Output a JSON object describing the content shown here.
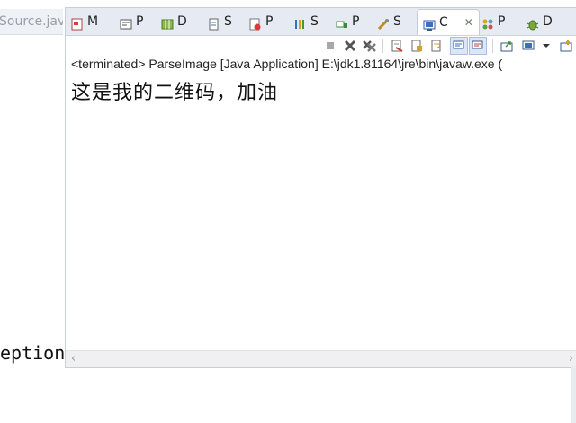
{
  "editor": {
    "tab_label": "Source.jav",
    "code_fragment": "eption",
    "code_rest": ";"
  },
  "tabs": [
    {
      "label": "M",
      "icon": "markers-icon"
    },
    {
      "label": "P",
      "icon": "properties-icon"
    },
    {
      "label": "D",
      "icon": "data-source-icon"
    },
    {
      "label": "S",
      "icon": "snippets-icon"
    },
    {
      "label": "P",
      "icon": "problems-icon"
    },
    {
      "label": "S",
      "icon": "search-icon"
    },
    {
      "label": "P",
      "icon": "progress-icon"
    },
    {
      "label": "S",
      "icon": "servers-icon"
    },
    {
      "label": "C",
      "icon": "console-icon",
      "active": true,
      "close": "✕"
    },
    {
      "label": "P",
      "icon": "plugins-icon"
    },
    {
      "label": "D",
      "icon": "debug-icon"
    }
  ],
  "console": {
    "header": "<terminated> ParseImage [Java Application] E:\\jdk1.81164\\jre\\bin\\javaw.exe (",
    "output": "这是我的二维码，加油"
  },
  "colors": {
    "tabbar_bg": "#e6ebf3",
    "pressed_bg": "#dbe7f7"
  }
}
